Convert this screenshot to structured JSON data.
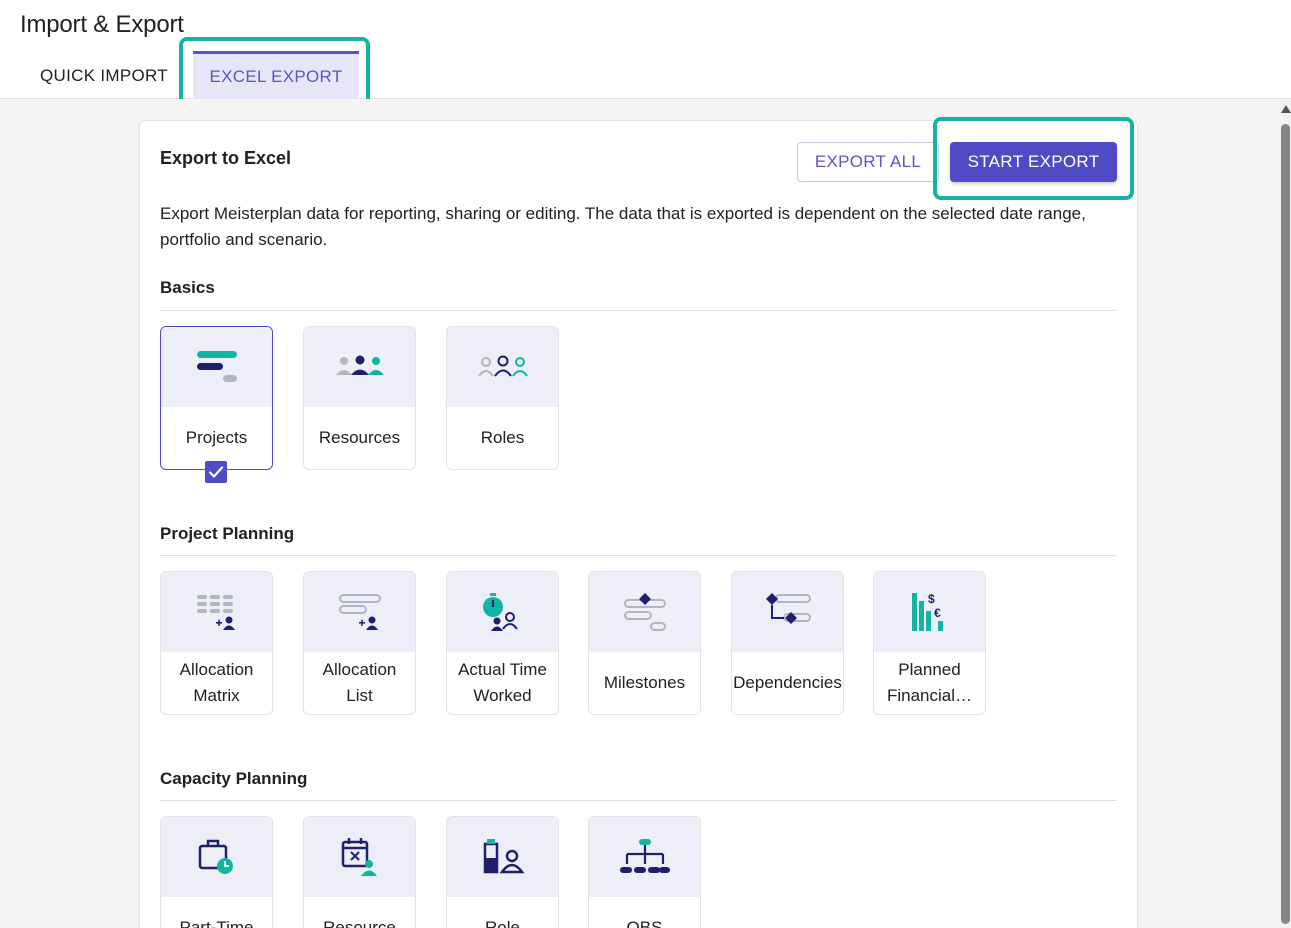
{
  "app": {
    "title": "Import & Export"
  },
  "tabs": [
    {
      "label": "QUICK IMPORT",
      "active": false
    },
    {
      "label": "EXCEL EXPORT",
      "active": true
    }
  ],
  "card": {
    "title": "Export to Excel",
    "export_all_label": "EXPORT ALL",
    "start_export_label": "START EXPORT",
    "description": "Export Meisterplan data for reporting, sharing or editing. The data that is exported is dependent on the selected date range, portfolio and scenario."
  },
  "sections": {
    "basics": {
      "title": "Basics",
      "tiles": [
        {
          "label": "Projects",
          "icon": "projects-icon",
          "selected": true
        },
        {
          "label": "Resources",
          "icon": "resources-icon",
          "selected": false
        },
        {
          "label": "Roles",
          "icon": "roles-icon",
          "selected": false
        }
      ]
    },
    "project_planning": {
      "title": "Project Planning",
      "tiles": [
        {
          "label": "Allocation Matrix",
          "icon": "allocation-matrix-icon"
        },
        {
          "label": "Allocation List",
          "icon": "allocation-list-icon"
        },
        {
          "label": "Actual Time Worked",
          "icon": "stopwatch-icon"
        },
        {
          "label": "Milestones",
          "icon": "milestones-icon"
        },
        {
          "label": "Dependencies",
          "icon": "dependencies-icon"
        },
        {
          "label": "Planned Financial…",
          "icon": "financials-icon"
        }
      ]
    },
    "capacity_planning": {
      "title": "Capacity Planning",
      "tiles": [
        {
          "label": "Part-Time",
          "icon": "part-time-icon"
        },
        {
          "label": "Resource",
          "icon": "resource-calendar-icon"
        },
        {
          "label": "Role",
          "icon": "role-capacity-icon"
        },
        {
          "label": "OBS",
          "icon": "obs-icon"
        }
      ]
    }
  },
  "colors": {
    "accent": "#4f4bc4",
    "navy": "#1f1f6b",
    "teal": "#12b5a3",
    "gray": "#b3b3c6",
    "highlight": "#12b5a3"
  }
}
